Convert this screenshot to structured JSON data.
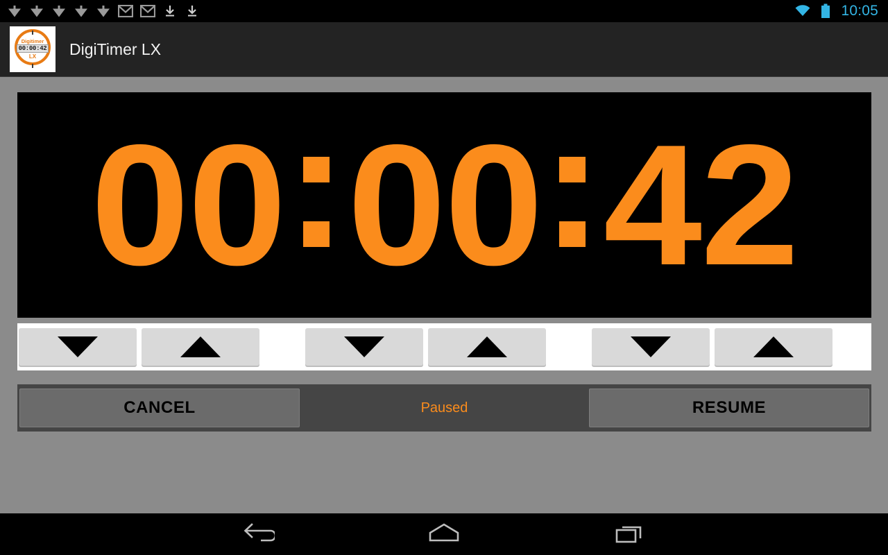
{
  "status_bar": {
    "background": "#000000",
    "clock": "10:05",
    "clock_color": "#33b5e5",
    "notification_icons": [
      "download-arrow-icon",
      "download-arrow-icon",
      "download-arrow-icon",
      "download-arrow-icon",
      "download-arrow-icon",
      "gmail-icon",
      "gmail-icon",
      "download-complete-icon",
      "download-complete-icon"
    ],
    "system_icons": [
      "wifi-icon",
      "battery-icon"
    ]
  },
  "action_bar": {
    "background": "#232323",
    "title": "DigiTimer LX",
    "app_icon": {
      "name": "digitimer-app-icon",
      "brand": "Digitimer",
      "lcd_value": "00:00:42",
      "suffix": "LX",
      "ring_color": "#e87b14"
    }
  },
  "timer": {
    "display_background": "#000000",
    "digit_color": "#fb8c1c",
    "hours": "00",
    "minutes": "00",
    "seconds": "42",
    "separator": ":",
    "full_value": "00:00:42"
  },
  "adjusters": {
    "background": "#ffffff",
    "button_background": "#d9d9d9",
    "groups": [
      {
        "unit": "hours",
        "buttons": [
          {
            "name": "hours-decrement-button",
            "icon": "triangle-down-icon",
            "direction": "down"
          },
          {
            "name": "hours-increment-button",
            "icon": "triangle-up-icon",
            "direction": "up"
          }
        ]
      },
      {
        "unit": "minutes",
        "buttons": [
          {
            "name": "minutes-decrement-button",
            "icon": "triangle-down-icon",
            "direction": "down"
          },
          {
            "name": "minutes-increment-button",
            "icon": "triangle-up-icon",
            "direction": "up"
          }
        ]
      },
      {
        "unit": "seconds",
        "buttons": [
          {
            "name": "seconds-decrement-button",
            "icon": "triangle-down-icon",
            "direction": "down"
          },
          {
            "name": "seconds-increment-button",
            "icon": "triangle-up-icon",
            "direction": "up"
          }
        ]
      }
    ]
  },
  "controls": {
    "background": "#454545",
    "button_background": "#6b6b6b",
    "cancel_label": "CANCEL",
    "status_label": "Paused",
    "status_color": "#fb8c1c",
    "resume_label": "RESUME"
  },
  "nav_bar": {
    "background": "#000000",
    "buttons": [
      {
        "name": "nav-back-button",
        "icon": "back-arrow-icon"
      },
      {
        "name": "nav-home-button",
        "icon": "home-icon"
      },
      {
        "name": "nav-recents-button",
        "icon": "recents-icon"
      }
    ]
  },
  "page": {
    "background": "#8b8b8b"
  }
}
